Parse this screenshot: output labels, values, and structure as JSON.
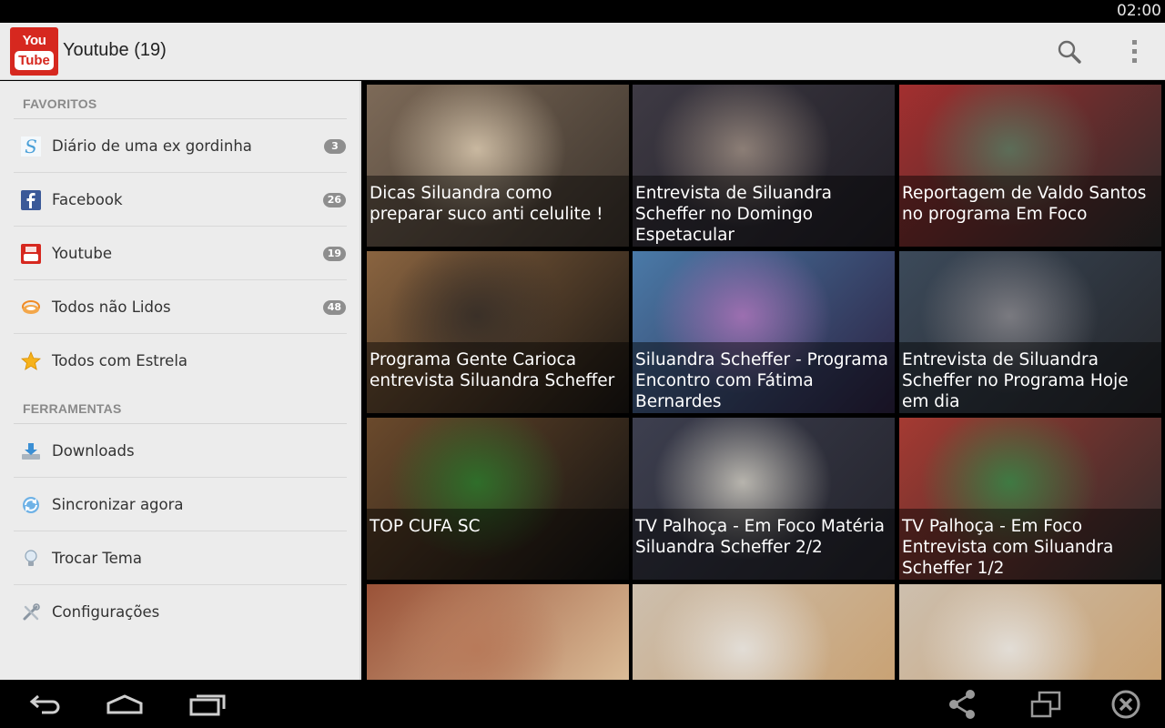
{
  "status_bar": {
    "time": "02:00"
  },
  "action_bar": {
    "logo": {
      "top": "You",
      "bottom": "Tube"
    },
    "title": "Youtube (19)",
    "icons": {
      "search": "search-icon",
      "overflow": "overflow-menu-icon"
    }
  },
  "sidebar": {
    "section_favorites": "FAVORITOS",
    "favorites": [
      {
        "label": "Diário de uma ex gordinha",
        "count": "3",
        "icon": "blog-s-icon"
      },
      {
        "label": "Facebook",
        "count": "26",
        "icon": "facebook-icon"
      },
      {
        "label": "Youtube",
        "count": "19",
        "icon": "youtube-icon"
      },
      {
        "label": "Todos não Lidos",
        "count": "48",
        "icon": "unread-stack-icon"
      },
      {
        "label": "Todos com Estrela",
        "count": "",
        "icon": "star-icon"
      }
    ],
    "section_tools": "FERRAMENTAS",
    "tools": [
      {
        "label": "Downloads",
        "icon": "download-icon"
      },
      {
        "label": "Sincronizar agora",
        "icon": "sync-icon"
      },
      {
        "label": "Trocar Tema",
        "icon": "lightbulb-icon"
      },
      {
        "label": "Configurações",
        "icon": "settings-tools-icon"
      }
    ]
  },
  "videos": [
    {
      "title": "Dicas Siluandra como preparar suco anti celulite !",
      "colors": [
        "#c9b8a0",
        "#7d6a58",
        "#3b332c"
      ]
    },
    {
      "title": "Entrevista de Siluandra Scheffer no Domingo Espetacular",
      "colors": [
        "#8c7e76",
        "#3e3a44",
        "#1f1d24"
      ]
    },
    {
      "title": "Reportagem de Valdo Santos no programa Em Foco",
      "colors": [
        "#5c6d58",
        "#a32f2f",
        "#2b2b2b"
      ]
    },
    {
      "title": "Programa Gente Carioca entrevista Siluandra Scheffer",
      "colors": [
        "#3a3028",
        "#8a6440",
        "#1a1612"
      ]
    },
    {
      "title": "Siluandra Scheffer - Programa Encontro com Fátima Bernardes",
      "colors": [
        "#9c6fb0",
        "#4a7aa8",
        "#2b2140"
      ]
    },
    {
      "title": "Entrevista de Siluandra Scheffer no Programa Hoje em dia",
      "colors": [
        "#7a7a80",
        "#3c4a5a",
        "#232428"
      ]
    },
    {
      "title": "TOP CUFA SC",
      "colors": [
        "#2f6e2a",
        "#6b4a2c",
        "#101010"
      ]
    },
    {
      "title": "TV Palhoça - Em Foco Matéria Siluandra Scheffer 2/2",
      "colors": [
        "#b7b4ad",
        "#3d3f4f",
        "#22222a"
      ]
    },
    {
      "title": "TV Palhoça - Em Foco Entrevista com Siluandra Scheffer 1/2",
      "colors": [
        "#3f7a43",
        "#a53a32",
        "#2a2a2a"
      ]
    },
    {
      "title": "",
      "colors": [
        "#b87a5a",
        "#9a5238",
        "#e6cfa8"
      ]
    },
    {
      "title": "",
      "colors": [
        "#e2ddd6",
        "#cdbfae",
        "#c89d6a"
      ]
    },
    {
      "title": "",
      "colors": [
        "#e2ddd6",
        "#cdbfae",
        "#c89d6a"
      ]
    }
  ],
  "nav_bar": {
    "icons": [
      "back-icon",
      "home-icon",
      "recent-apps-icon",
      "share-icon",
      "window-icon",
      "close-circle-icon"
    ]
  }
}
